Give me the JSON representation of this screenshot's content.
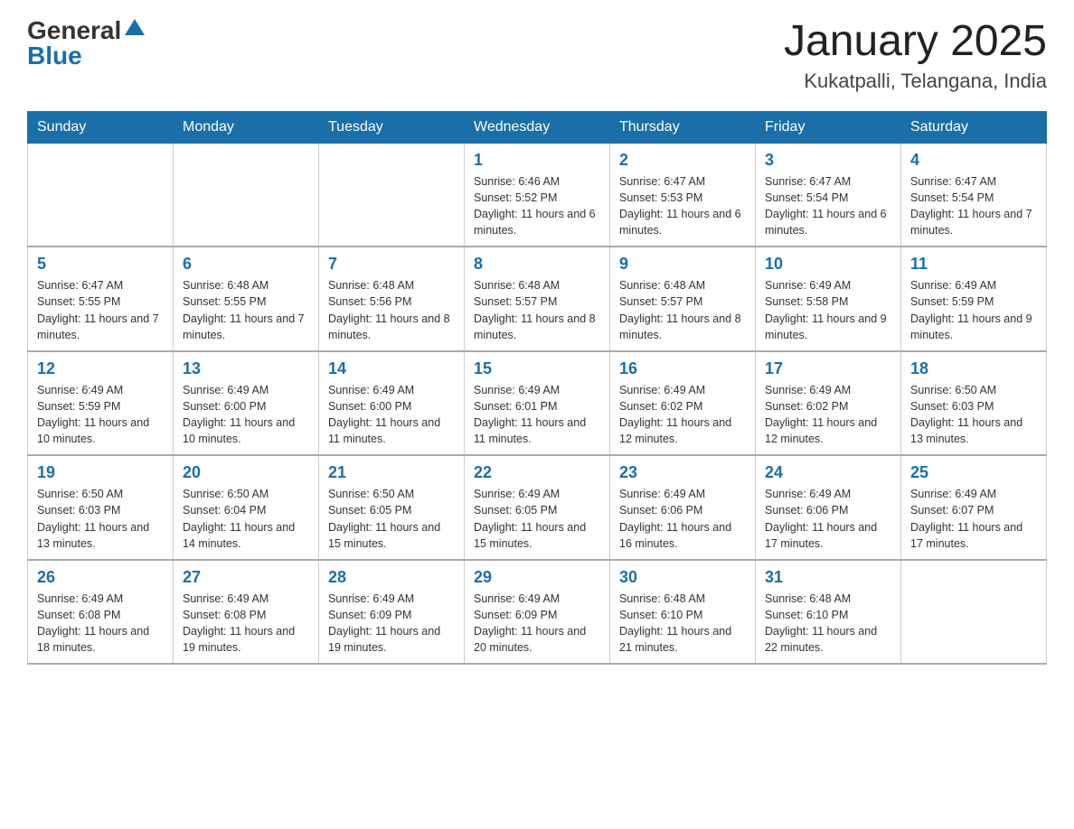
{
  "logo": {
    "general": "General",
    "blue": "Blue"
  },
  "title": "January 2025",
  "location": "Kukatpalli, Telangana, India",
  "days_of_week": [
    "Sunday",
    "Monday",
    "Tuesday",
    "Wednesday",
    "Thursday",
    "Friday",
    "Saturday"
  ],
  "weeks": [
    [
      {
        "day": "",
        "info": ""
      },
      {
        "day": "",
        "info": ""
      },
      {
        "day": "",
        "info": ""
      },
      {
        "day": "1",
        "info": "Sunrise: 6:46 AM\nSunset: 5:52 PM\nDaylight: 11 hours and 6 minutes."
      },
      {
        "day": "2",
        "info": "Sunrise: 6:47 AM\nSunset: 5:53 PM\nDaylight: 11 hours and 6 minutes."
      },
      {
        "day": "3",
        "info": "Sunrise: 6:47 AM\nSunset: 5:54 PM\nDaylight: 11 hours and 6 minutes."
      },
      {
        "day": "4",
        "info": "Sunrise: 6:47 AM\nSunset: 5:54 PM\nDaylight: 11 hours and 7 minutes."
      }
    ],
    [
      {
        "day": "5",
        "info": "Sunrise: 6:47 AM\nSunset: 5:55 PM\nDaylight: 11 hours and 7 minutes."
      },
      {
        "day": "6",
        "info": "Sunrise: 6:48 AM\nSunset: 5:55 PM\nDaylight: 11 hours and 7 minutes."
      },
      {
        "day": "7",
        "info": "Sunrise: 6:48 AM\nSunset: 5:56 PM\nDaylight: 11 hours and 8 minutes."
      },
      {
        "day": "8",
        "info": "Sunrise: 6:48 AM\nSunset: 5:57 PM\nDaylight: 11 hours and 8 minutes."
      },
      {
        "day": "9",
        "info": "Sunrise: 6:48 AM\nSunset: 5:57 PM\nDaylight: 11 hours and 8 minutes."
      },
      {
        "day": "10",
        "info": "Sunrise: 6:49 AM\nSunset: 5:58 PM\nDaylight: 11 hours and 9 minutes."
      },
      {
        "day": "11",
        "info": "Sunrise: 6:49 AM\nSunset: 5:59 PM\nDaylight: 11 hours and 9 minutes."
      }
    ],
    [
      {
        "day": "12",
        "info": "Sunrise: 6:49 AM\nSunset: 5:59 PM\nDaylight: 11 hours and 10 minutes."
      },
      {
        "day": "13",
        "info": "Sunrise: 6:49 AM\nSunset: 6:00 PM\nDaylight: 11 hours and 10 minutes."
      },
      {
        "day": "14",
        "info": "Sunrise: 6:49 AM\nSunset: 6:00 PM\nDaylight: 11 hours and 11 minutes."
      },
      {
        "day": "15",
        "info": "Sunrise: 6:49 AM\nSunset: 6:01 PM\nDaylight: 11 hours and 11 minutes."
      },
      {
        "day": "16",
        "info": "Sunrise: 6:49 AM\nSunset: 6:02 PM\nDaylight: 11 hours and 12 minutes."
      },
      {
        "day": "17",
        "info": "Sunrise: 6:49 AM\nSunset: 6:02 PM\nDaylight: 11 hours and 12 minutes."
      },
      {
        "day": "18",
        "info": "Sunrise: 6:50 AM\nSunset: 6:03 PM\nDaylight: 11 hours and 13 minutes."
      }
    ],
    [
      {
        "day": "19",
        "info": "Sunrise: 6:50 AM\nSunset: 6:03 PM\nDaylight: 11 hours and 13 minutes."
      },
      {
        "day": "20",
        "info": "Sunrise: 6:50 AM\nSunset: 6:04 PM\nDaylight: 11 hours and 14 minutes."
      },
      {
        "day": "21",
        "info": "Sunrise: 6:50 AM\nSunset: 6:05 PM\nDaylight: 11 hours and 15 minutes."
      },
      {
        "day": "22",
        "info": "Sunrise: 6:49 AM\nSunset: 6:05 PM\nDaylight: 11 hours and 15 minutes."
      },
      {
        "day": "23",
        "info": "Sunrise: 6:49 AM\nSunset: 6:06 PM\nDaylight: 11 hours and 16 minutes."
      },
      {
        "day": "24",
        "info": "Sunrise: 6:49 AM\nSunset: 6:06 PM\nDaylight: 11 hours and 17 minutes."
      },
      {
        "day": "25",
        "info": "Sunrise: 6:49 AM\nSunset: 6:07 PM\nDaylight: 11 hours and 17 minutes."
      }
    ],
    [
      {
        "day": "26",
        "info": "Sunrise: 6:49 AM\nSunset: 6:08 PM\nDaylight: 11 hours and 18 minutes."
      },
      {
        "day": "27",
        "info": "Sunrise: 6:49 AM\nSunset: 6:08 PM\nDaylight: 11 hours and 19 minutes."
      },
      {
        "day": "28",
        "info": "Sunrise: 6:49 AM\nSunset: 6:09 PM\nDaylight: 11 hours and 19 minutes."
      },
      {
        "day": "29",
        "info": "Sunrise: 6:49 AM\nSunset: 6:09 PM\nDaylight: 11 hours and 20 minutes."
      },
      {
        "day": "30",
        "info": "Sunrise: 6:48 AM\nSunset: 6:10 PM\nDaylight: 11 hours and 21 minutes."
      },
      {
        "day": "31",
        "info": "Sunrise: 6:48 AM\nSunset: 6:10 PM\nDaylight: 11 hours and 22 minutes."
      },
      {
        "day": "",
        "info": ""
      }
    ]
  ]
}
